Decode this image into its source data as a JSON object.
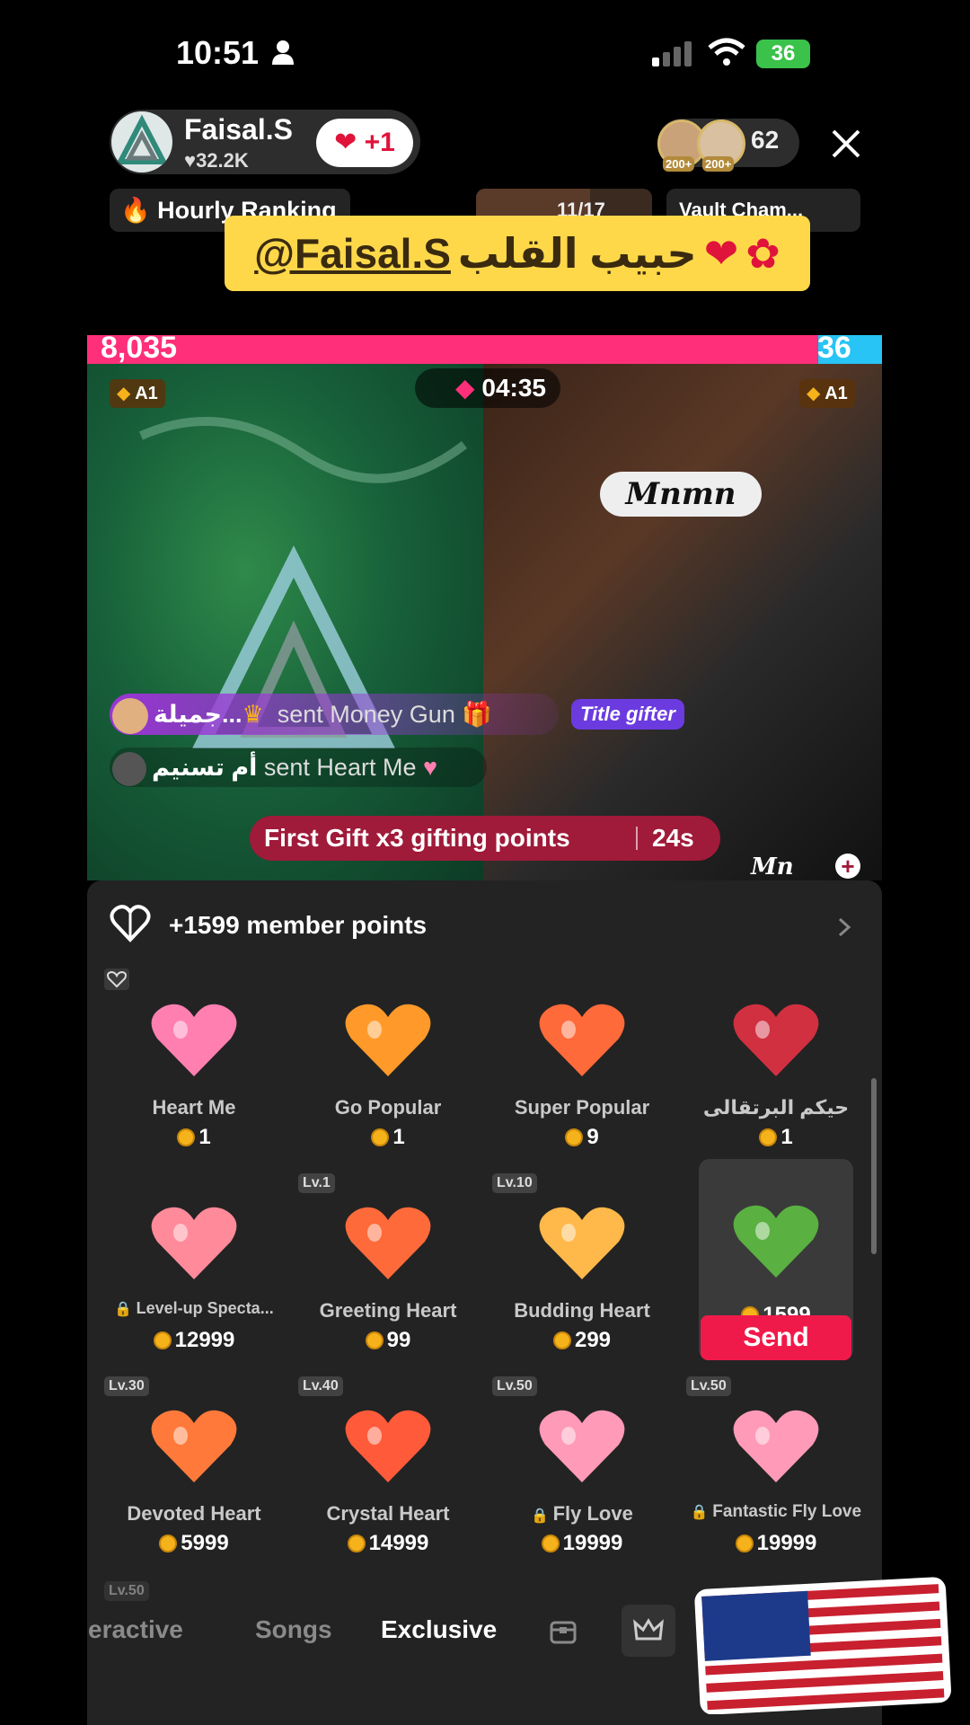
{
  "status_bar": {
    "time": "10:51",
    "battery": "36"
  },
  "host": {
    "name": "Faisal.S",
    "likes": "32.2K",
    "plus": "+1"
  },
  "viewers": {
    "badges": [
      "200+",
      "200+"
    ],
    "count": "62"
  },
  "ranking": {
    "hourly": "Hourly Ranking",
    "progress": "11/17",
    "progress_value": 0.647,
    "vault": "Vault Cham..."
  },
  "banner": {
    "mention": "@Faisal.S",
    "text": "حبيب القلب"
  },
  "battle": {
    "score_left": "8,035",
    "score_right": "36",
    "timer": "04:35",
    "left_badge": "A1",
    "right_badge": "A1"
  },
  "messages": [
    {
      "user": "جميلة...",
      "text": "sent Money Gun"
    },
    {
      "user": "أم تسنيم",
      "text": "sent Heart Me"
    }
  ],
  "title_gifter": "Title gifter",
  "first_gift": {
    "text": "First Gift x3 gifting points",
    "seconds": "24s"
  },
  "right_label": "Mn",
  "member_points": "+1599 member points",
  "gifts": [
    {
      "name": "Heart Me",
      "price": "1",
      "level": ""
    },
    {
      "name": "Go Popular",
      "price": "1",
      "level": ""
    },
    {
      "name": "Super Popular",
      "price": "9",
      "level": ""
    },
    {
      "name": "حيكم البرتقالى",
      "price": "1",
      "level": ""
    },
    {
      "name": "Level-up Specta...",
      "price": "12999",
      "level": ""
    },
    {
      "name": "Greeting Heart",
      "price": "99",
      "level": "Lv.1"
    },
    {
      "name": "Budding Heart",
      "price": "299",
      "level": "Lv.10"
    },
    {
      "name": "",
      "price": "1599",
      "level": ""
    },
    {
      "name": "Devoted Heart",
      "price": "5999",
      "level": "Lv.30"
    },
    {
      "name": "Crystal Heart",
      "price": "14999",
      "level": "Lv.40"
    },
    {
      "name": "Fly Love",
      "price": "19999",
      "level": "Lv.50"
    },
    {
      "name": "Fantastic Fly Love",
      "price": "19999",
      "level": "Lv.50"
    }
  ],
  "send_label": "Send",
  "next_level": "Lv.50",
  "tabs": [
    "eractive",
    "Songs",
    "Exclusive"
  ],
  "colors": {
    "accent": "#f01a4a",
    "battle_left": "#ff2f7a",
    "battle_right": "#27c4f5",
    "banner": "#ffd84a",
    "coin": "#f6b21b"
  }
}
